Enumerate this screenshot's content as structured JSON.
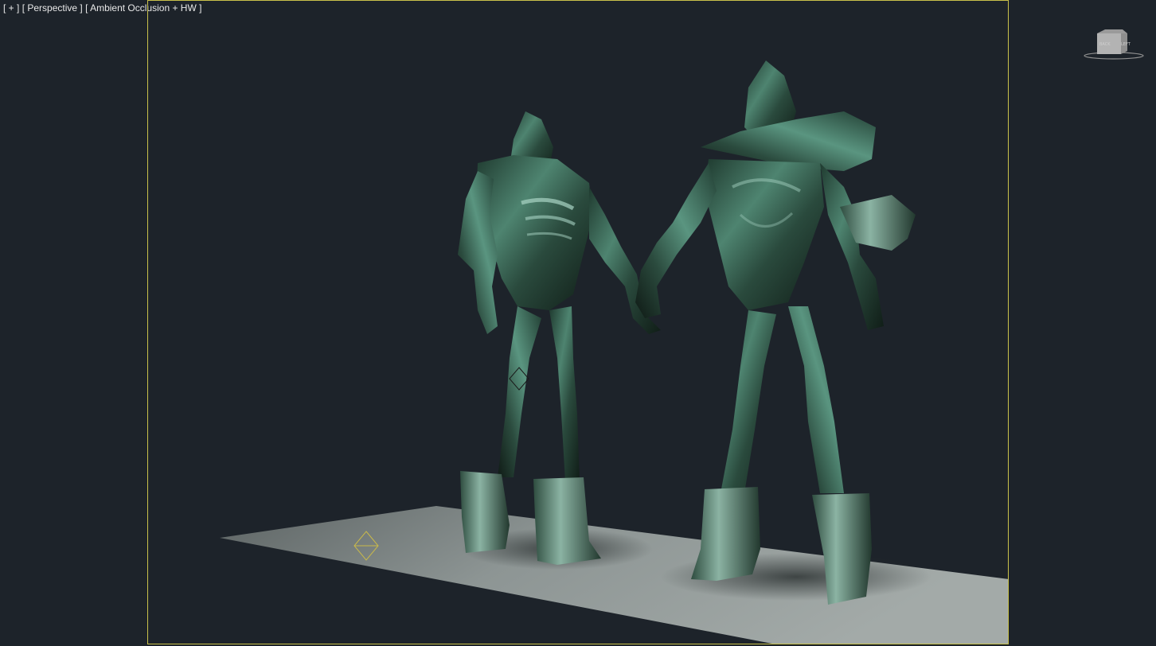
{
  "viewport": {
    "menu_label": "[ + ]",
    "view_label": "[ Perspective ]",
    "shading_label": "[ Ambient Occlusion + HW ]"
  },
  "viewcube": {
    "face_label": "BACK",
    "side_label": "LEFT"
  },
  "colors": {
    "background": "#1d232a",
    "safe_frame": "#c9c14a",
    "ground": "#9aa19f",
    "character_skin": "#3f6a58"
  },
  "icons": [
    "viewcube-icon",
    "light-helper-icon"
  ]
}
